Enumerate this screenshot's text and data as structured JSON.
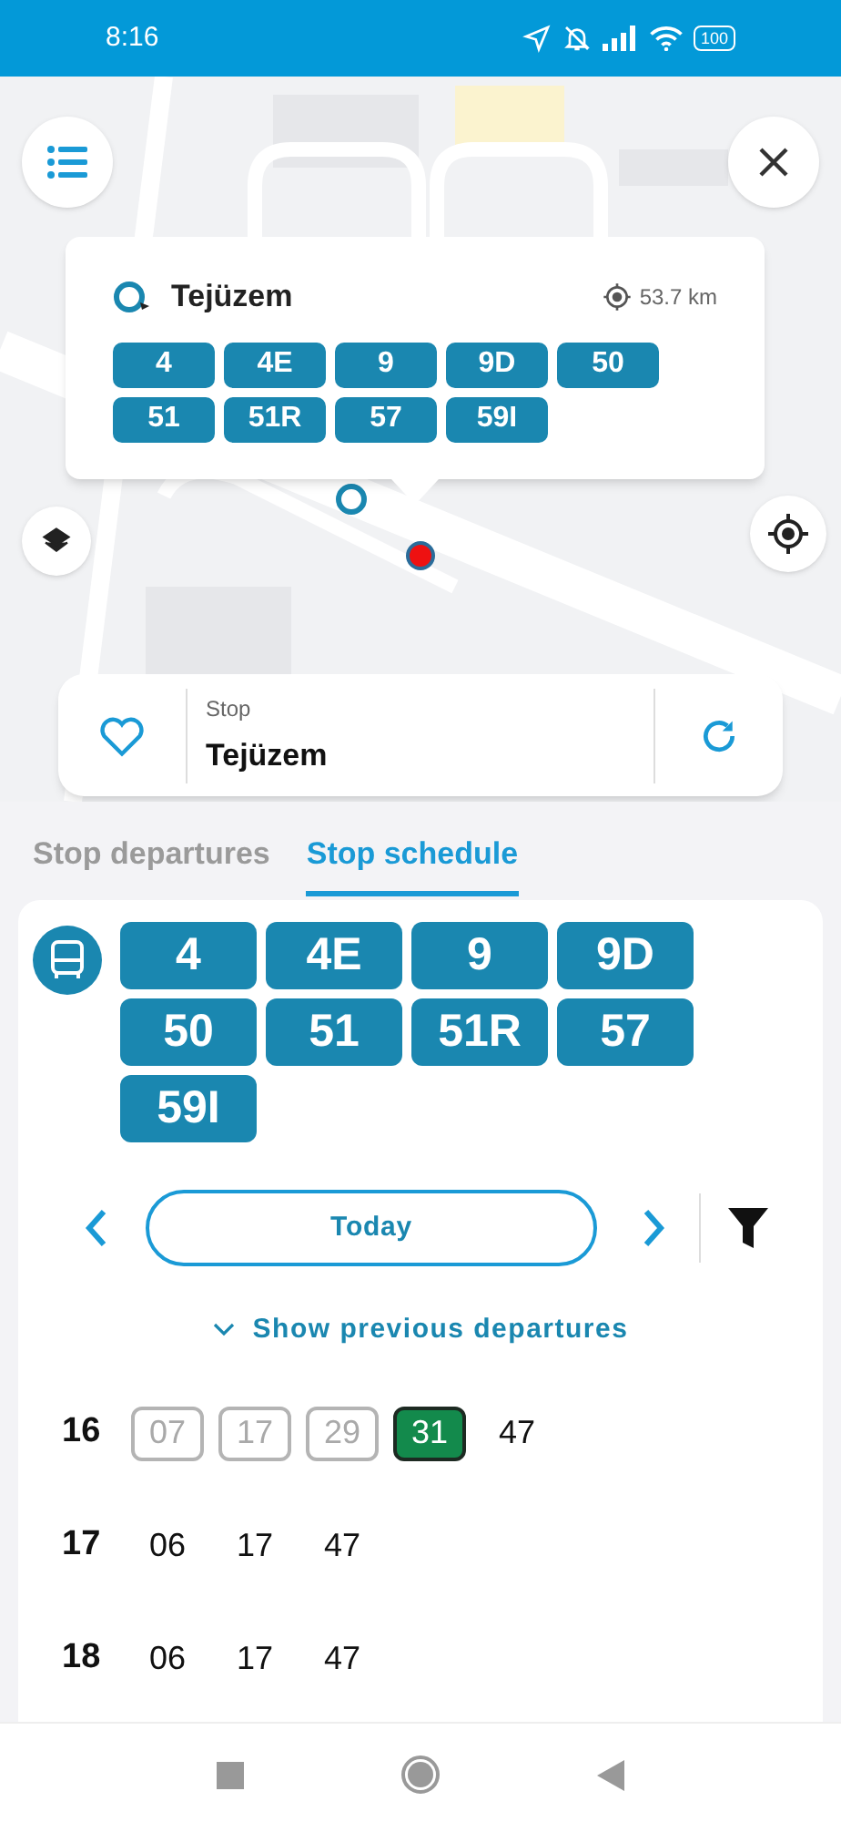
{
  "status_bar": {
    "time": "8:16",
    "battery": "100"
  },
  "popup": {
    "stop_name": "Tejüzem",
    "distance": "53.7 km",
    "routes": [
      "4",
      "4E",
      "9",
      "9D",
      "50",
      "51",
      "51R",
      "57",
      "59I"
    ]
  },
  "stop_card": {
    "label": "Stop",
    "name": "Tejüzem",
    "favorite": false
  },
  "tabs": [
    {
      "label": "Stop departures",
      "selected": false
    },
    {
      "label": "Stop schedule",
      "selected": true
    }
  ],
  "schedule": {
    "routes": [
      "4",
      "4E",
      "9",
      "9D",
      "50",
      "51",
      "51R",
      "57",
      "59I"
    ],
    "day": "Today",
    "show_previous": "Show previous departures",
    "hours": [
      {
        "hour": "16",
        "minutes": [
          {
            "text": "07",
            "kind": "past"
          },
          {
            "text": "17",
            "kind": "past"
          },
          {
            "text": "29",
            "kind": "past"
          },
          {
            "text": "31",
            "kind": "next"
          },
          {
            "text": "47",
            "kind": "upcoming"
          }
        ]
      },
      {
        "hour": "17",
        "minutes": [
          {
            "text": "06",
            "kind": "upcoming"
          },
          {
            "text": "17",
            "kind": "upcoming"
          },
          {
            "text": "47",
            "kind": "upcoming"
          }
        ]
      },
      {
        "hour": "18",
        "minutes": [
          {
            "text": "06",
            "kind": "upcoming"
          },
          {
            "text": "17",
            "kind": "upcoming"
          },
          {
            "text": "47",
            "kind": "upcoming"
          }
        ]
      }
    ]
  }
}
